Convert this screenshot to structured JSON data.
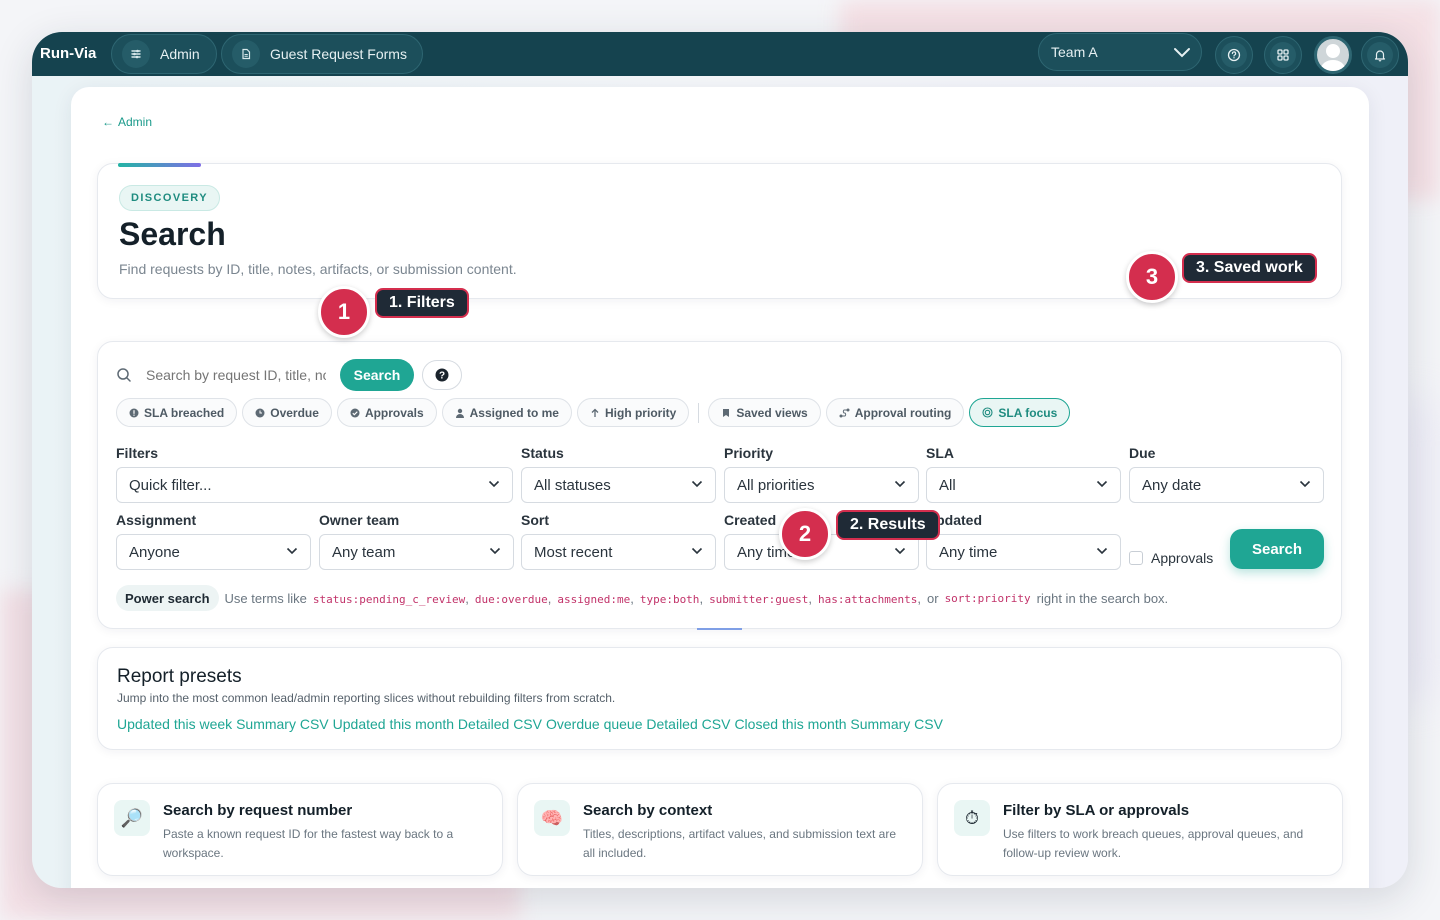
{
  "app": {
    "brand": "Run-Via",
    "nav": [
      {
        "label": "Admin",
        "icon": "sliders-icon"
      },
      {
        "label": "Guest Request Forms",
        "icon": "document-icon"
      }
    ],
    "team": "Team A",
    "actions": [
      "help-icon",
      "apps-grid-icon",
      "avatar",
      "bell-icon"
    ]
  },
  "breadcrumb": {
    "back_label": "Admin"
  },
  "hero": {
    "badge": "DISCOVERY",
    "title": "Search",
    "subtitle": "Find requests by ID, title, notes, artifacts, or submission content."
  },
  "callouts": [
    {
      "number": "1",
      "label": "1. Filters"
    },
    {
      "number": "2",
      "label": "2. Results"
    },
    {
      "number": "3",
      "label": "3. Saved work"
    }
  ],
  "search": {
    "placeholder": "Search by request ID, title, notes...",
    "button": "Search",
    "help": "?"
  },
  "chips": [
    {
      "label": "SLA breached",
      "icon": "alert-dot-icon"
    },
    {
      "label": "Overdue",
      "icon": "clock-icon"
    },
    {
      "label": "Approvals",
      "icon": "check-circle-icon"
    },
    {
      "label": "Assigned to me",
      "icon": "user-icon"
    },
    {
      "label": "High priority",
      "icon": "arrow-up-icon"
    },
    {
      "label": "Saved views",
      "icon": "bookmark-icon"
    },
    {
      "label": "Approval routing",
      "icon": "route-icon"
    },
    {
      "label": "SLA focus",
      "icon": "target-icon",
      "active": true
    }
  ],
  "filters": {
    "filters": {
      "label": "Filters",
      "value": "Quick filter..."
    },
    "status": {
      "label": "Status",
      "value": "All statuses"
    },
    "priority": {
      "label": "Priority",
      "value": "All priorities"
    },
    "sla": {
      "label": "SLA",
      "value": "All"
    },
    "due": {
      "label": "Due",
      "value": "Any date"
    },
    "assignment": {
      "label": "Assignment",
      "value": "Anyone"
    },
    "owner_team": {
      "label": "Owner team",
      "value": "Any team"
    },
    "sort": {
      "label": "Sort",
      "value": "Most recent"
    },
    "created": {
      "label": "Created",
      "value": "Any time"
    },
    "updated": {
      "label": "Updated",
      "value": "Any time"
    },
    "approvals_label": "Approvals",
    "search_button": "Search"
  },
  "power": {
    "badge": "Power search",
    "prefix": "Use terms like",
    "terms": [
      "status:pending_c_review",
      "due:overdue",
      "assigned:me",
      "type:both",
      "submitter:guest",
      "has:attachments"
    ],
    "or": "or",
    "last_term": "sort:priority",
    "suffix": "right in the search box."
  },
  "presets": {
    "title": "Report presets",
    "description": "Jump into the most common lead/admin reporting slices without rebuilding filters from scratch.",
    "links": [
      "Updated this week Summary CSV",
      "Updated this month Detailed CSV",
      "Overdue queue Detailed CSV",
      "Closed this month Summary CSV"
    ]
  },
  "tips": [
    {
      "title": "Search by request number",
      "text": "Paste a known request ID for the fastest way back to a workspace.",
      "icon": "magnifier-icon"
    },
    {
      "title": "Search by context",
      "text": "Titles, descriptions, artifact values, and submission text are all included.",
      "icon": "brain-icon"
    },
    {
      "title": "Filter by SLA or approvals",
      "text": "Use filters to work breach queues, approval queues, and follow-up review work.",
      "icon": "stopwatch-icon"
    }
  ]
}
